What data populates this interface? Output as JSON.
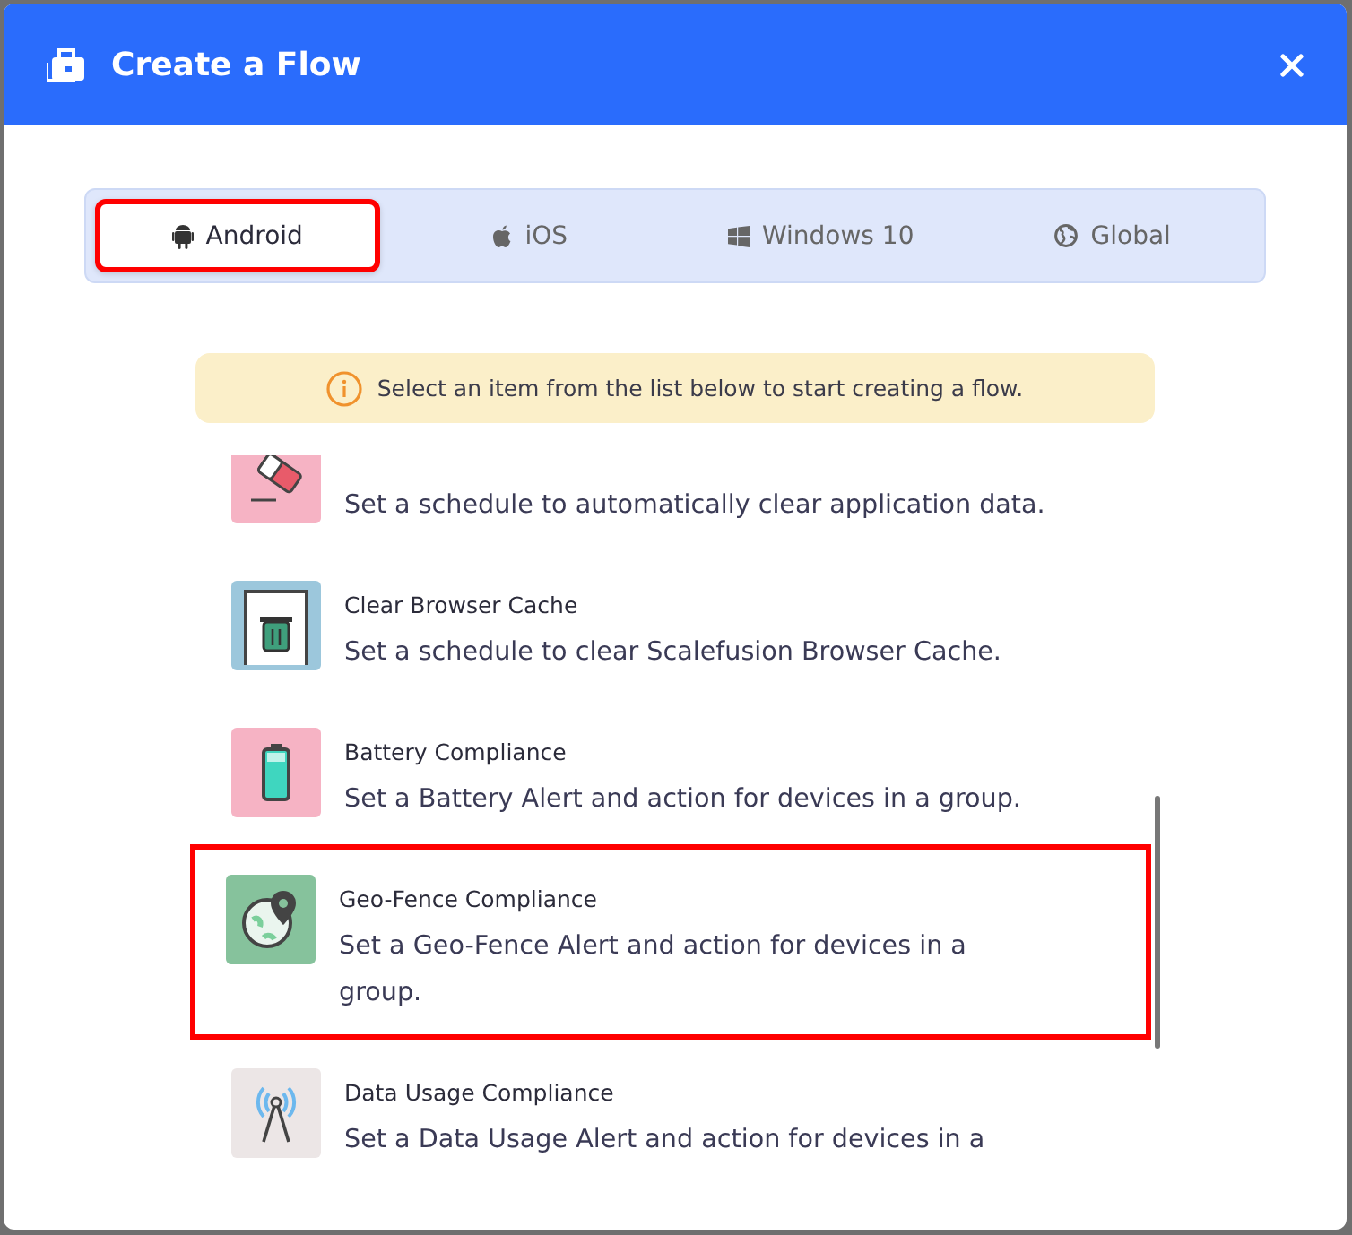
{
  "dialog": {
    "title": "Create a Flow"
  },
  "tabs": [
    {
      "label": "Android",
      "kind": "android",
      "selected": true,
      "highlighted": true
    },
    {
      "label": "iOS",
      "kind": "apple",
      "selected": false,
      "highlighted": false
    },
    {
      "label": "Windows 10",
      "kind": "windows",
      "selected": false,
      "highlighted": false
    },
    {
      "label": "Global",
      "kind": "globe",
      "selected": false,
      "highlighted": false
    }
  ],
  "notice": "Select an item from the list below to start creating a flow.",
  "items": [
    {
      "kind": "eraser",
      "description": "Set a schedule to automatically clear application data.",
      "highlighted": false
    },
    {
      "kind": "trash",
      "title": "Clear Browser Cache",
      "description": "Set a schedule to clear Scalefusion Browser Cache.",
      "highlighted": false
    },
    {
      "kind": "battery",
      "title": "Battery Compliance",
      "description": "Set a Battery Alert and action for devices in a group.",
      "highlighted": false
    },
    {
      "kind": "geofence",
      "title": "Geo-Fence Compliance",
      "description": "Set a Geo-Fence Alert and action for devices in a group.",
      "highlighted": true
    },
    {
      "kind": "antenna",
      "title": "Data Usage Compliance",
      "description": "Set a Data Usage Alert and action for devices in a",
      "highlighted": false
    }
  ]
}
